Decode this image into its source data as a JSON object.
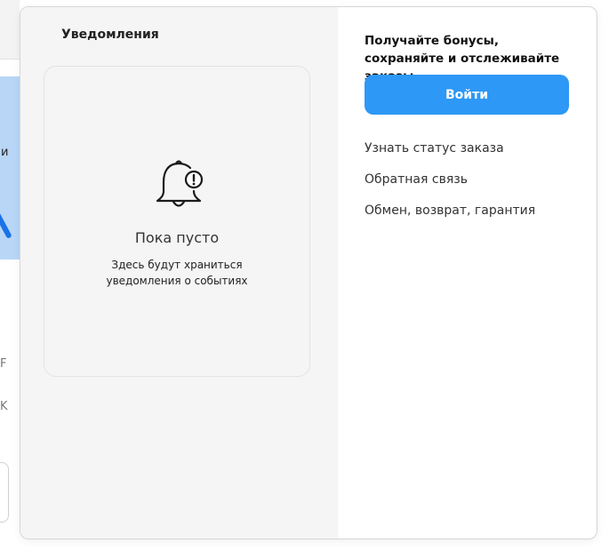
{
  "notifications": {
    "title": "Уведомления",
    "empty_title": "Пока пусто",
    "empty_desc_line1": "Здесь будут храниться",
    "empty_desc_line2": "уведомления о событиях"
  },
  "account": {
    "promo_text": "Получайте бонусы, сохраняйте и отслеживайте заказы",
    "login_label": "Войти",
    "links": [
      "Узнать статус заказа",
      "Обратная связь",
      "Обмен, возврат, гарантия"
    ]
  },
  "background": {
    "fragments": [
      "и",
      "F",
      "K"
    ]
  },
  "colors": {
    "accent": "#2d98f5",
    "panel_bg": "#f5f5f5",
    "banner_bg": "#b9d6f7"
  },
  "icons": {
    "bell": "bell-alert-icon"
  }
}
